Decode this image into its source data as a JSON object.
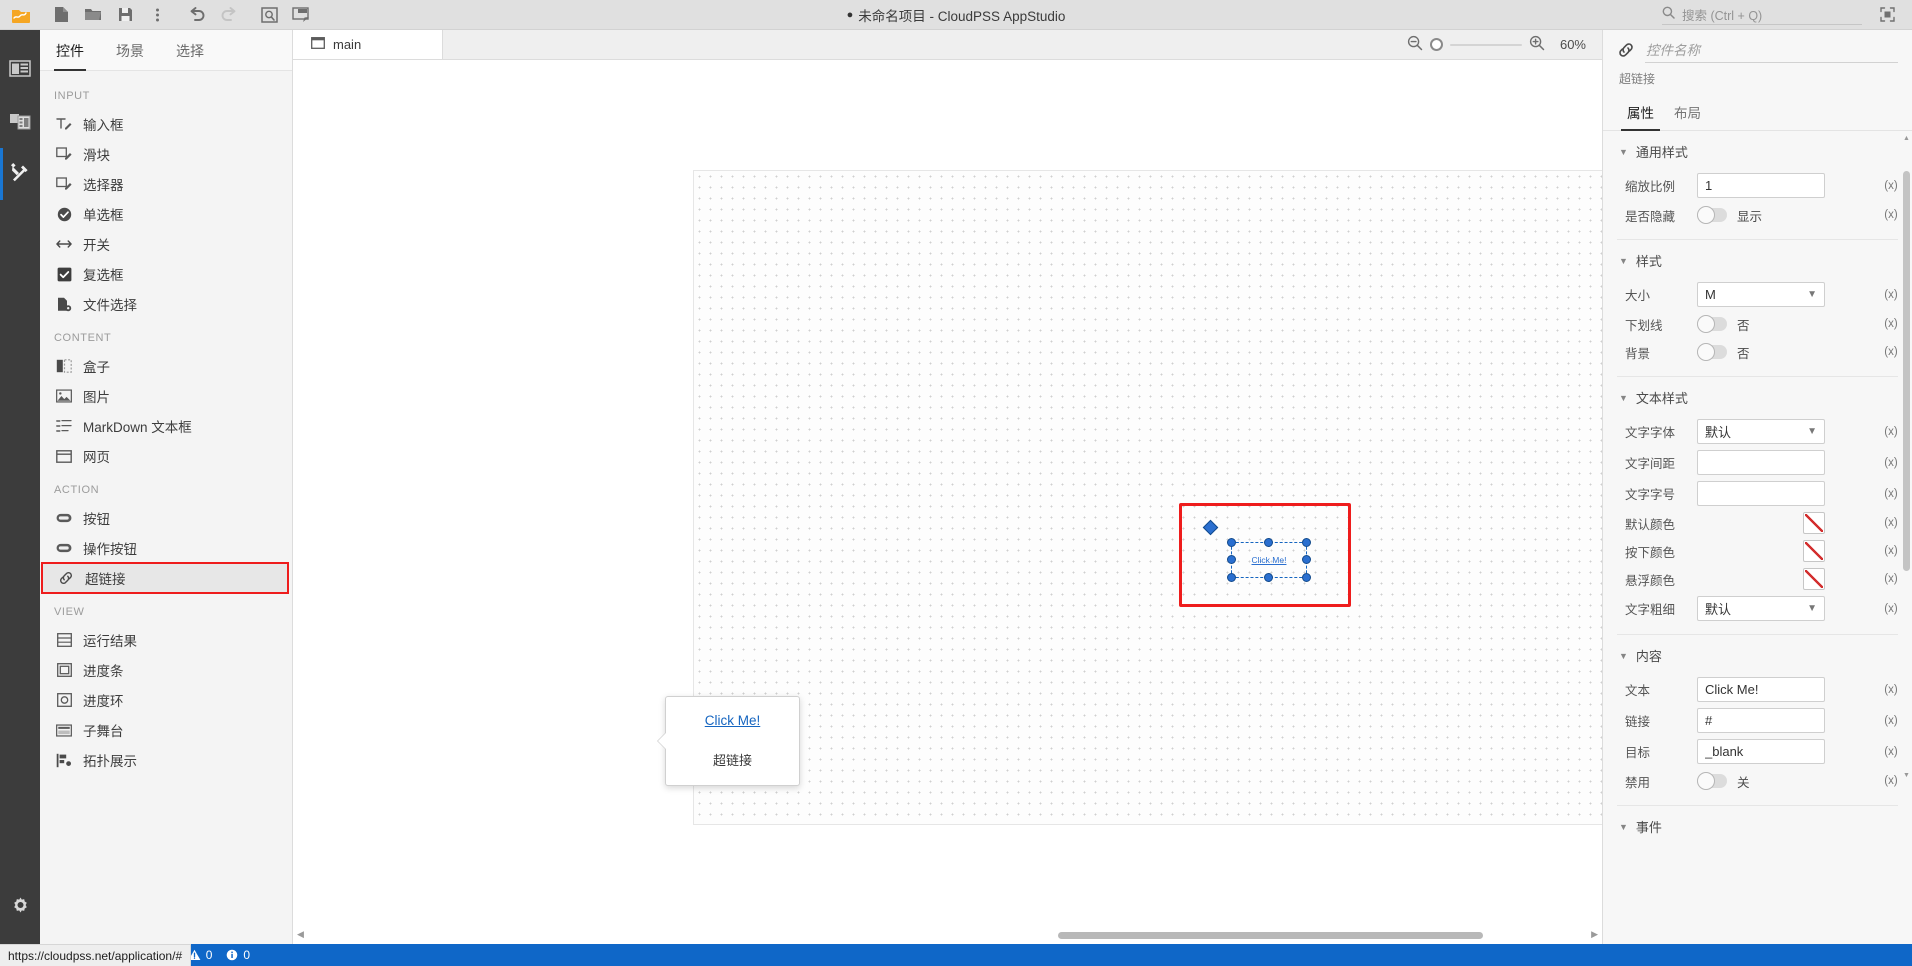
{
  "titlebar": {
    "project_dot": "●",
    "title": "未命名项目 - CloudPSS AppStudio",
    "toolbar_icons": [
      {
        "name": "app-logo-icon",
        "label": "CloudPSS"
      },
      {
        "name": "new-file-icon",
        "label": "新建"
      },
      {
        "name": "open-folder-icon",
        "label": "打开"
      },
      {
        "name": "save-icon",
        "label": "保存"
      },
      {
        "name": "more-vertical-icon",
        "label": "更多"
      },
      {
        "name": "undo-icon",
        "label": "撤销"
      },
      {
        "name": "redo-icon",
        "label": "重做"
      },
      {
        "name": "preview-icon",
        "label": "预览"
      },
      {
        "name": "publish-icon",
        "label": "发布"
      }
    ],
    "search_placeholder": "搜索 (Ctrl + Q)",
    "search_value": "",
    "fullscreen_label": "全屏"
  },
  "rail": {
    "items": [
      {
        "name": "sidebar-rail-project",
        "icon": "panel-layout-icon",
        "active": false
      },
      {
        "name": "sidebar-rail-resources",
        "icon": "media-stack-icon",
        "active": false
      },
      {
        "name": "sidebar-rail-widgets",
        "icon": "tools-icon",
        "active": true
      }
    ],
    "settings_icon": "gear-icon"
  },
  "panel": {
    "tabs": [
      {
        "label": "控件",
        "active": true
      },
      {
        "label": "场景",
        "active": false
      },
      {
        "label": "选择",
        "active": false
      }
    ],
    "groups": [
      {
        "title": "INPUT",
        "items": [
          {
            "label": "输入框",
            "icon": "text-input-icon",
            "highlighted": false
          },
          {
            "label": "滑块",
            "icon": "slider-icon",
            "highlighted": false
          },
          {
            "label": "选择器",
            "icon": "selector-icon",
            "highlighted": false
          },
          {
            "label": "单选框",
            "icon": "radio-icon",
            "highlighted": false
          },
          {
            "label": "开关",
            "icon": "switch-icon",
            "highlighted": false
          },
          {
            "label": "复选框",
            "icon": "checkbox-icon",
            "highlighted": false
          },
          {
            "label": "文件选择",
            "icon": "file-picker-icon",
            "highlighted": false
          }
        ]
      },
      {
        "title": "CONTENT",
        "items": [
          {
            "label": "盒子",
            "icon": "box-icon",
            "highlighted": false
          },
          {
            "label": "图片",
            "icon": "image-icon",
            "highlighted": false
          },
          {
            "label": "MarkDown 文本框",
            "icon": "markdown-icon",
            "highlighted": false
          },
          {
            "label": "网页",
            "icon": "webpage-icon",
            "highlighted": false
          }
        ]
      },
      {
        "title": "ACTION",
        "items": [
          {
            "label": "按钮",
            "icon": "button-icon",
            "highlighted": false
          },
          {
            "label": "操作按钮",
            "icon": "action-button-icon",
            "highlighted": false
          },
          {
            "label": "超链接",
            "icon": "link-icon",
            "highlighted": true
          }
        ]
      },
      {
        "title": "VIEW",
        "items": [
          {
            "label": "运行结果",
            "icon": "results-icon",
            "highlighted": false
          },
          {
            "label": "进度条",
            "icon": "progress-bar-icon",
            "highlighted": false
          },
          {
            "label": "进度环",
            "icon": "progress-ring-icon",
            "highlighted": false
          },
          {
            "label": "子舞台",
            "icon": "substage-icon",
            "highlighted": false
          },
          {
            "label": "拓扑展示",
            "icon": "topology-icon",
            "highlighted": false
          }
        ]
      }
    ]
  },
  "editor": {
    "tab": {
      "label": "main",
      "icon": "window-icon"
    },
    "zoom": {
      "out_label": "缩小",
      "in_label": "放大",
      "level": "60%"
    },
    "selection": {
      "text": "Click Me!",
      "handles": 8,
      "rotate_handle": true
    },
    "tooltip": {
      "link_text": "Click Me!",
      "type_label": "超链接"
    }
  },
  "props": {
    "name_placeholder": "控件名称",
    "name_value": "",
    "widget_type": "超链接",
    "icon": "link-icon",
    "tabs": [
      {
        "label": "属性",
        "active": true
      },
      {
        "label": "布局",
        "active": false
      }
    ],
    "bind_marker": "(x)",
    "sections": [
      {
        "title": "通用样式",
        "rows": [
          {
            "label": "缩放比例",
            "type": "input",
            "value": "1"
          },
          {
            "label": "是否隐藏",
            "type": "toggle",
            "value": "显示",
            "on": false
          }
        ]
      },
      {
        "title": "样式",
        "rows": [
          {
            "label": "大小",
            "type": "select",
            "value": "M"
          },
          {
            "label": "下划线",
            "type": "toggle",
            "value": "否",
            "on": false
          },
          {
            "label": "背景",
            "type": "toggle",
            "value": "否",
            "on": false
          }
        ]
      },
      {
        "title": "文本样式",
        "rows": [
          {
            "label": "文字字体",
            "type": "select",
            "value": "默认"
          },
          {
            "label": "文字间距",
            "type": "input",
            "value": ""
          },
          {
            "label": "文字字号",
            "type": "input",
            "value": ""
          },
          {
            "label": "默认颜色",
            "type": "color",
            "value": ""
          },
          {
            "label": "按下颜色",
            "type": "color",
            "value": ""
          },
          {
            "label": "悬浮颜色",
            "type": "color",
            "value": ""
          },
          {
            "label": "文字粗细",
            "type": "select",
            "value": "默认"
          }
        ]
      },
      {
        "title": "内容",
        "rows": [
          {
            "label": "文本",
            "type": "input",
            "value": "Click Me!"
          },
          {
            "label": "链接",
            "type": "input",
            "value": "#"
          },
          {
            "label": "目标",
            "type": "input",
            "value": "_blank"
          },
          {
            "label": "禁用",
            "type": "toggle",
            "value": "关",
            "on": false
          }
        ]
      },
      {
        "title": "事件",
        "rows": []
      }
    ]
  },
  "statusbar": {
    "url_hint": "https://cloudpss.net/application/#",
    "errors": "0",
    "warnings": "0",
    "infos": "0"
  },
  "colors": {
    "accent": "#0f67c8",
    "highlight_red": "#ee1c1c",
    "selection_blue": "#2a6fd0",
    "rail_bg": "#3c3c3c",
    "panel_bg": "#f4f4f4"
  }
}
